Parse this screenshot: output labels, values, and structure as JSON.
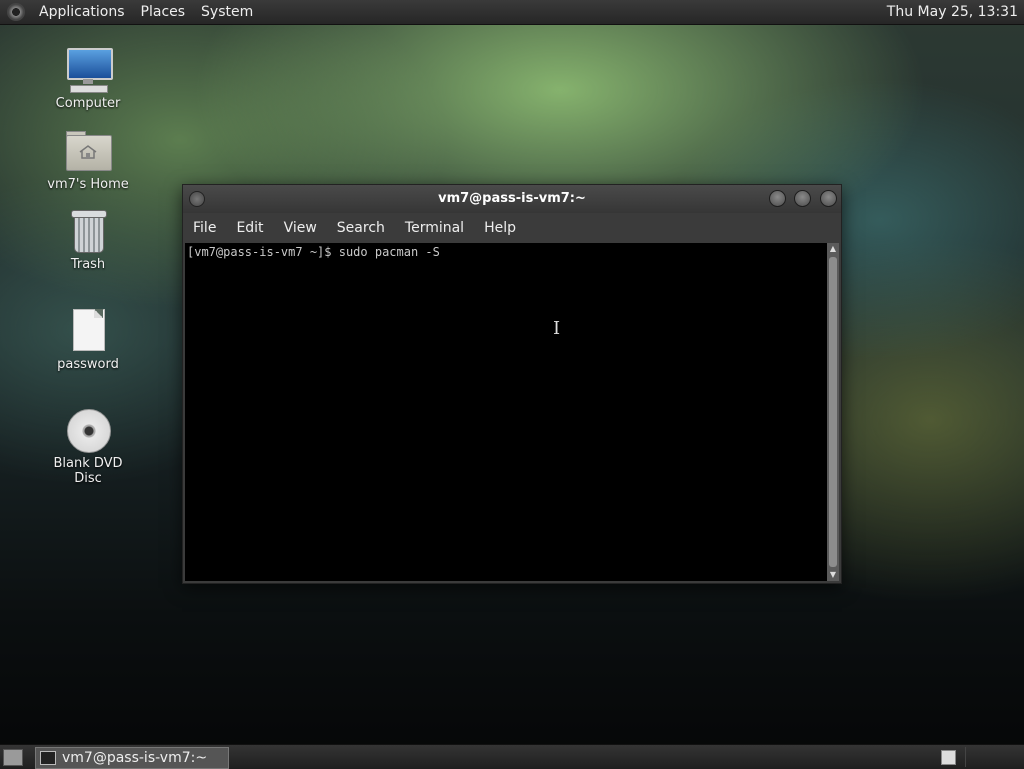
{
  "top_panel": {
    "menus": [
      "Applications",
      "Places",
      "System"
    ],
    "clock": "Thu May 25, 13:31"
  },
  "desktop": {
    "icons": [
      {
        "label": "Computer",
        "icon": "computer-icon"
      },
      {
        "label": "vm7's Home",
        "icon": "home-folder-icon"
      },
      {
        "label": "Trash",
        "icon": "trash-icon"
      },
      {
        "label": "password",
        "icon": "file-icon"
      },
      {
        "label": "Blank DVD Disc",
        "icon": "dvd-icon"
      }
    ]
  },
  "terminal": {
    "title": "vm7@pass-is-vm7:~",
    "menu": [
      "File",
      "Edit",
      "View",
      "Search",
      "Terminal",
      "Help"
    ],
    "prompt": "[vm7@pass-is-vm7 ~]$ sudo pacman -S"
  },
  "bottom_panel": {
    "task_label": "vm7@pass-is-vm7:~"
  }
}
